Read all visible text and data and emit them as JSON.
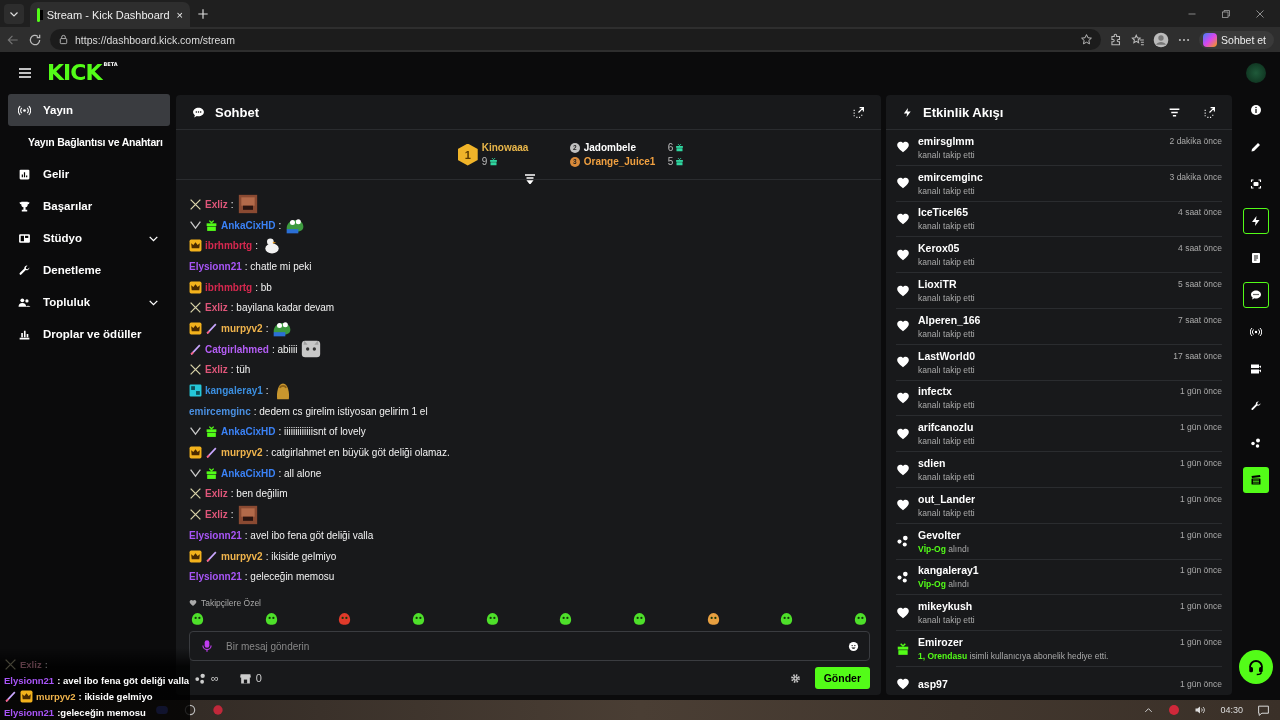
{
  "browser": {
    "tab": {
      "title": "Stream - Kick Dashboard",
      "close": "×"
    },
    "url": "https://dashboard.kick.com/stream",
    "copilot": "Sohbet et"
  },
  "logo": {
    "text": "KICK",
    "tag": "BETA"
  },
  "sidebar": {
    "items": [
      {
        "label": "Yayın",
        "kind": "link",
        "selected": true,
        "children": [
          {
            "label": "Yayın Bağlantısı ve Anahtarı",
            "selected": false
          }
        ]
      },
      {
        "label": "Gelir",
        "kind": "link",
        "selected": false
      },
      {
        "label": "Başarılar",
        "kind": "link",
        "selected": false
      },
      {
        "label": "Stüdyo",
        "kind": "group",
        "selected": false
      },
      {
        "label": "Denetleme",
        "kind": "link",
        "selected": false
      },
      {
        "label": "Topluluk",
        "kind": "group",
        "selected": false
      },
      {
        "label": "Droplar ve ödüller",
        "kind": "link",
        "selected": false
      }
    ]
  },
  "chat": {
    "title": "Sohbet",
    "leaderboard": [
      {
        "rank": "1",
        "name": "Kinowaaa",
        "count": "9",
        "color": "#e8b64a"
      },
      {
        "rank": "2",
        "name": "Jadombele",
        "count": "6",
        "color": "#ffffff"
      },
      {
        "rank": "3",
        "name": "Orange_Juice1",
        "count": "5",
        "color": "#f0a040"
      }
    ],
    "messages": [
      {
        "user": "Exliz",
        "color": "#e0567a",
        "badges": [
          {
            "kind": "swords"
          }
        ],
        "text": ":",
        "emote": {
          "kind": "face"
        }
      },
      {
        "user": "AnkaCixHD",
        "color": "#3b82f6",
        "badges": [
          {
            "kind": "chevron"
          },
          {
            "kind": "gift"
          }
        ],
        "text": ":",
        "emote": {
          "kind": "frog"
        }
      },
      {
        "user": "ibrhmbrtg",
        "color": "#d6284f",
        "badges": [
          {
            "kind": "crown"
          }
        ],
        "text": ":",
        "emote": {
          "kind": "duck"
        }
      },
      {
        "user": "Elysionn21",
        "color": "#a855f7",
        "text": ": chatle mi peki"
      },
      {
        "user": "ibrhmbrtg",
        "color": "#d6284f",
        "badges": [
          {
            "kind": "crown"
          }
        ],
        "text": ": bb"
      },
      {
        "user": "Exliz",
        "color": "#e0567a",
        "badges": [
          {
            "kind": "swords"
          }
        ],
        "text": ": bayilana kadar devam"
      },
      {
        "user": "murpyv2",
        "color": "#f0b44c",
        "badges": [
          {
            "kind": "crown"
          },
          {
            "kind": "pen"
          }
        ],
        "text": ":",
        "emote": {
          "kind": "frog"
        }
      },
      {
        "user": "Catgirlahmed",
        "color": "#b45ef5",
        "badges": [
          {
            "kind": "pen"
          }
        ],
        "text": ": abiiii",
        "emote": {
          "kind": "cat"
        }
      },
      {
        "user": "Exliz",
        "color": "#e0567a",
        "badges": [
          {
            "kind": "swords"
          }
        ],
        "text": ": tüh"
      },
      {
        "user": "kangaleray1",
        "color": "#3b8fe0",
        "badges": [
          {
            "kind": "og"
          }
        ],
        "text": ":",
        "emote": {
          "kind": "blob"
        }
      },
      {
        "user": "emircemginc",
        "color": "#4a8fe0",
        "text": ": dedem cs girelim istiyosan gelirim 1 el"
      },
      {
        "user": "AnkaCixHD",
        "color": "#3b82f6",
        "badges": [
          {
            "kind": "chevron"
          },
          {
            "kind": "gift"
          }
        ],
        "text": ": iiiiiiiiiiiiisnt of lovely"
      },
      {
        "user": "murpyv2",
        "color": "#f0b44c",
        "badges": [
          {
            "kind": "crown"
          },
          {
            "kind": "pen"
          }
        ],
        "text": ": catgirlahmet en büyük göt deliği olamaz."
      },
      {
        "user": "AnkaCixHD",
        "color": "#3b82f6",
        "badges": [
          {
            "kind": "chevron"
          },
          {
            "kind": "gift"
          }
        ],
        "text": ": all alone"
      },
      {
        "user": "Exliz",
        "color": "#e0567a",
        "badges": [
          {
            "kind": "swords"
          }
        ],
        "text": ": ben değilim"
      },
      {
        "user": "Exliz",
        "color": "#e0567a",
        "badges": [
          {
            "kind": "swords"
          }
        ],
        "text": ":",
        "emote": {
          "kind": "face"
        }
      },
      {
        "user": "Elysionn21",
        "color": "#a855f7",
        "text": ": avel ibo fena göt deliği valla"
      },
      {
        "user": "murpyv2",
        "color": "#f0b44c",
        "badges": [
          {
            "kind": "crown"
          },
          {
            "kind": "pen"
          }
        ],
        "text": ": ikiside gelmiyo"
      },
      {
        "user": "Elysionn21",
        "color": "#a855f7",
        "text": ": geleceğin memosu"
      }
    ],
    "emote_label": "Takipçilere Özel",
    "input": {
      "placeholder": "Bir mesaj gönderin"
    },
    "points": "∞",
    "store": "0",
    "send": "Gönder"
  },
  "feed": {
    "title": "Etkinlik Akışı",
    "items": [
      {
        "kind": "follow",
        "user": "emirsglmm",
        "time": "2 dakika önce",
        "text": "kanalı takip etti"
      },
      {
        "kind": "follow",
        "user": "emircemginc",
        "time": "3 dakika önce",
        "text": "kanalı takip etti"
      },
      {
        "kind": "follow",
        "user": "IceTicel65",
        "time": "4 saat önce",
        "text": "kanalı takip etti"
      },
      {
        "kind": "follow",
        "user": "Kerox05",
        "time": "4 saat önce",
        "text": "kanalı takip etti"
      },
      {
        "kind": "follow",
        "user": "LioxiTR",
        "time": "5 saat önce",
        "text": "kanalı takip etti"
      },
      {
        "kind": "follow",
        "user": "Alperen_166",
        "time": "7 saat önce",
        "text": "kanalı takip etti"
      },
      {
        "kind": "follow",
        "user": "LastWorld0",
        "time": "17 saat önce",
        "text": "kanalı takip etti"
      },
      {
        "kind": "follow",
        "user": "infectx",
        "time": "1 gün önce",
        "text": "kanalı takip etti"
      },
      {
        "kind": "follow",
        "user": "arifcanozlu",
        "time": "1 gün önce",
        "text": "kanalı takip etti"
      },
      {
        "kind": "follow",
        "user": "sdien",
        "time": "1 gün önce",
        "text": "kanalı takip etti"
      },
      {
        "kind": "follow",
        "user": "out_Lander",
        "time": "1 gün önce",
        "text": "kanalı takip etti"
      },
      {
        "kind": "reward",
        "user": "Gevolter",
        "time": "1 gün önce",
        "highlight": "Vİp-Og",
        "text": "alındı"
      },
      {
        "kind": "reward",
        "user": "kangaleray1",
        "time": "1 gün önce",
        "highlight": "Vİp-Og",
        "text": "alındı"
      },
      {
        "kind": "follow",
        "user": "mikeykush",
        "time": "1 gün önce",
        "text": "kanalı takip etti"
      },
      {
        "kind": "gift",
        "user": "Emirozer",
        "time": "1 gün önce",
        "highlight": "1, Orendasu",
        "text": "isimli kullanıcıya abonelik hediye etti."
      },
      {
        "kind": "follow",
        "user": "asp97",
        "time": "1 gün önce"
      }
    ]
  },
  "rail": [
    {
      "kind": "info",
      "selected": false
    },
    {
      "kind": "pencil",
      "selected": false
    },
    {
      "kind": "capture",
      "selected": false
    },
    {
      "kind": "bolt",
      "selected": true
    },
    {
      "kind": "document",
      "selected": false
    },
    {
      "kind": "chat",
      "selected": true
    },
    {
      "kind": "broadcast",
      "selected": false
    },
    {
      "kind": "video",
      "selected": false
    },
    {
      "kind": "wrench",
      "selected": false
    },
    {
      "kind": "dots",
      "selected": false
    },
    {
      "kind": "clapper",
      "selected": false
    }
  ],
  "overlay": [
    {
      "user": "Exliz",
      "text": ":",
      "faded": true,
      "badges": [
        {
          "kind": "swords"
        }
      ]
    },
    {
      "user": "Elysionn21",
      "color": "#a855f7",
      "text": ": avel ibo fena göt deliği valla",
      "faded": false
    },
    {
      "user": "murpyv2",
      "color": "#f0b44c",
      "text": ": ikiside gelmiyo",
      "faded": false,
      "badges": [
        {
          "kind": "pen"
        },
        {
          "kind": "crown"
        }
      ]
    },
    {
      "user": "Elysionn21",
      "color": "#a855f7",
      "text": ":geleceğin memosu",
      "faded": false
    }
  ],
  "taskbar": {
    "time": "04:30"
  }
}
